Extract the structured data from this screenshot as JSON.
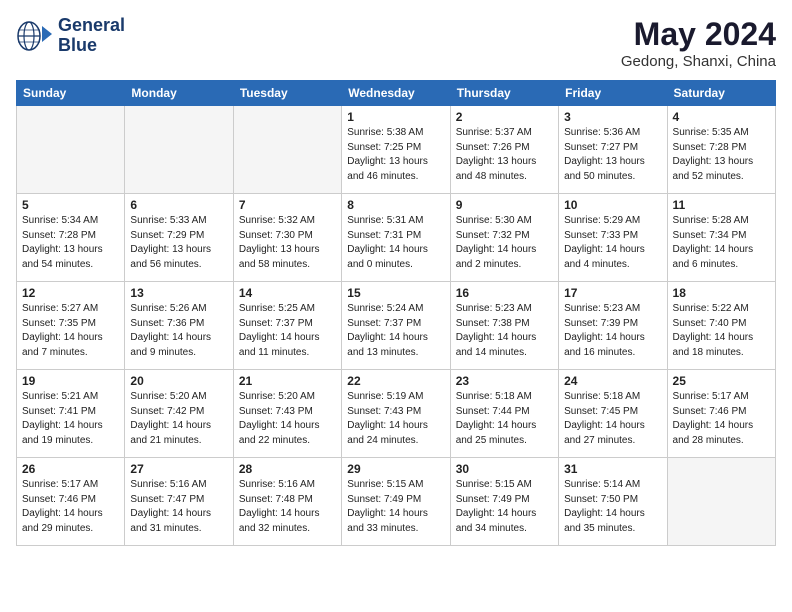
{
  "header": {
    "logo_line1": "General",
    "logo_line2": "Blue",
    "month": "May 2024",
    "location": "Gedong, Shanxi, China"
  },
  "weekdays": [
    "Sunday",
    "Monday",
    "Tuesday",
    "Wednesday",
    "Thursday",
    "Friday",
    "Saturday"
  ],
  "weeks": [
    [
      {
        "day": "",
        "info": "",
        "empty": true
      },
      {
        "day": "",
        "info": "",
        "empty": true
      },
      {
        "day": "",
        "info": "",
        "empty": true
      },
      {
        "day": "1",
        "info": "Sunrise: 5:38 AM\nSunset: 7:25 PM\nDaylight: 13 hours\nand 46 minutes.",
        "empty": false
      },
      {
        "day": "2",
        "info": "Sunrise: 5:37 AM\nSunset: 7:26 PM\nDaylight: 13 hours\nand 48 minutes.",
        "empty": false
      },
      {
        "day": "3",
        "info": "Sunrise: 5:36 AM\nSunset: 7:27 PM\nDaylight: 13 hours\nand 50 minutes.",
        "empty": false
      },
      {
        "day": "4",
        "info": "Sunrise: 5:35 AM\nSunset: 7:28 PM\nDaylight: 13 hours\nand 52 minutes.",
        "empty": false
      }
    ],
    [
      {
        "day": "5",
        "info": "Sunrise: 5:34 AM\nSunset: 7:28 PM\nDaylight: 13 hours\nand 54 minutes.",
        "empty": false
      },
      {
        "day": "6",
        "info": "Sunrise: 5:33 AM\nSunset: 7:29 PM\nDaylight: 13 hours\nand 56 minutes.",
        "empty": false
      },
      {
        "day": "7",
        "info": "Sunrise: 5:32 AM\nSunset: 7:30 PM\nDaylight: 13 hours\nand 58 minutes.",
        "empty": false
      },
      {
        "day": "8",
        "info": "Sunrise: 5:31 AM\nSunset: 7:31 PM\nDaylight: 14 hours\nand 0 minutes.",
        "empty": false
      },
      {
        "day": "9",
        "info": "Sunrise: 5:30 AM\nSunset: 7:32 PM\nDaylight: 14 hours\nand 2 minutes.",
        "empty": false
      },
      {
        "day": "10",
        "info": "Sunrise: 5:29 AM\nSunset: 7:33 PM\nDaylight: 14 hours\nand 4 minutes.",
        "empty": false
      },
      {
        "day": "11",
        "info": "Sunrise: 5:28 AM\nSunset: 7:34 PM\nDaylight: 14 hours\nand 6 minutes.",
        "empty": false
      }
    ],
    [
      {
        "day": "12",
        "info": "Sunrise: 5:27 AM\nSunset: 7:35 PM\nDaylight: 14 hours\nand 7 minutes.",
        "empty": false
      },
      {
        "day": "13",
        "info": "Sunrise: 5:26 AM\nSunset: 7:36 PM\nDaylight: 14 hours\nand 9 minutes.",
        "empty": false
      },
      {
        "day": "14",
        "info": "Sunrise: 5:25 AM\nSunset: 7:37 PM\nDaylight: 14 hours\nand 11 minutes.",
        "empty": false
      },
      {
        "day": "15",
        "info": "Sunrise: 5:24 AM\nSunset: 7:37 PM\nDaylight: 14 hours\nand 13 minutes.",
        "empty": false
      },
      {
        "day": "16",
        "info": "Sunrise: 5:23 AM\nSunset: 7:38 PM\nDaylight: 14 hours\nand 14 minutes.",
        "empty": false
      },
      {
        "day": "17",
        "info": "Sunrise: 5:23 AM\nSunset: 7:39 PM\nDaylight: 14 hours\nand 16 minutes.",
        "empty": false
      },
      {
        "day": "18",
        "info": "Sunrise: 5:22 AM\nSunset: 7:40 PM\nDaylight: 14 hours\nand 18 minutes.",
        "empty": false
      }
    ],
    [
      {
        "day": "19",
        "info": "Sunrise: 5:21 AM\nSunset: 7:41 PM\nDaylight: 14 hours\nand 19 minutes.",
        "empty": false
      },
      {
        "day": "20",
        "info": "Sunrise: 5:20 AM\nSunset: 7:42 PM\nDaylight: 14 hours\nand 21 minutes.",
        "empty": false
      },
      {
        "day": "21",
        "info": "Sunrise: 5:20 AM\nSunset: 7:43 PM\nDaylight: 14 hours\nand 22 minutes.",
        "empty": false
      },
      {
        "day": "22",
        "info": "Sunrise: 5:19 AM\nSunset: 7:43 PM\nDaylight: 14 hours\nand 24 minutes.",
        "empty": false
      },
      {
        "day": "23",
        "info": "Sunrise: 5:18 AM\nSunset: 7:44 PM\nDaylight: 14 hours\nand 25 minutes.",
        "empty": false
      },
      {
        "day": "24",
        "info": "Sunrise: 5:18 AM\nSunset: 7:45 PM\nDaylight: 14 hours\nand 27 minutes.",
        "empty": false
      },
      {
        "day": "25",
        "info": "Sunrise: 5:17 AM\nSunset: 7:46 PM\nDaylight: 14 hours\nand 28 minutes.",
        "empty": false
      }
    ],
    [
      {
        "day": "26",
        "info": "Sunrise: 5:17 AM\nSunset: 7:46 PM\nDaylight: 14 hours\nand 29 minutes.",
        "empty": false
      },
      {
        "day": "27",
        "info": "Sunrise: 5:16 AM\nSunset: 7:47 PM\nDaylight: 14 hours\nand 31 minutes.",
        "empty": false
      },
      {
        "day": "28",
        "info": "Sunrise: 5:16 AM\nSunset: 7:48 PM\nDaylight: 14 hours\nand 32 minutes.",
        "empty": false
      },
      {
        "day": "29",
        "info": "Sunrise: 5:15 AM\nSunset: 7:49 PM\nDaylight: 14 hours\nand 33 minutes.",
        "empty": false
      },
      {
        "day": "30",
        "info": "Sunrise: 5:15 AM\nSunset: 7:49 PM\nDaylight: 14 hours\nand 34 minutes.",
        "empty": false
      },
      {
        "day": "31",
        "info": "Sunrise: 5:14 AM\nSunset: 7:50 PM\nDaylight: 14 hours\nand 35 minutes.",
        "empty": false
      },
      {
        "day": "",
        "info": "",
        "empty": true
      }
    ]
  ]
}
